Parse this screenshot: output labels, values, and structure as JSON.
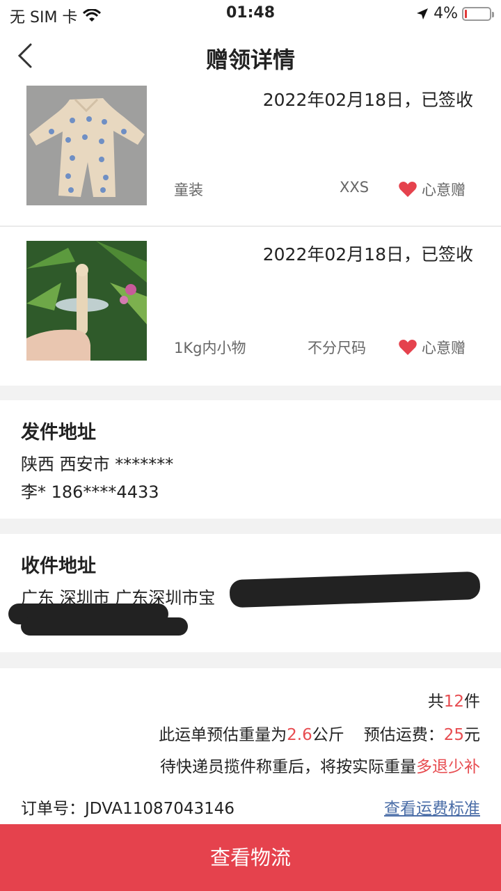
{
  "status": {
    "carrier": "无 SIM 卡",
    "time": "01:48",
    "battery": "4%"
  },
  "nav": {
    "title": "赠领详情"
  },
  "items": [
    {
      "date": "2022年02月18日，已签收",
      "category": "童装",
      "size": "XXS",
      "gift_label": "心意赠"
    },
    {
      "date": "2022年02月18日，已签收",
      "category": "1Kg内小物",
      "size": "不分尺码",
      "gift_label": "心意赠"
    }
  ],
  "sender": {
    "title": "发件地址",
    "region": "陕西 西安市 *******",
    "contact": "李* 186****4433"
  },
  "receiver": {
    "title": "收件地址",
    "region": "广东 深圳市 广东深圳市宝"
  },
  "summary": {
    "count_prefix": "共",
    "count": "12",
    "count_suffix": "件",
    "weight_prefix": "此运单预估重量为",
    "weight": "2.6",
    "weight_unit": "公斤",
    "fee_prefix": "预估运费：",
    "fee": "25",
    "fee_unit": "元",
    "note_prefix": "待快递员揽件称重后，将按实际重量",
    "note_highlight": "多退少补",
    "order_label": "订单号：",
    "order_number": "JDVA11087043146",
    "fee_link": "查看运费标准"
  },
  "bottom_button": "查看物流",
  "colors": {
    "accent": "#e5424d",
    "highlight": "#e74c50",
    "link": "#4a6da7"
  }
}
